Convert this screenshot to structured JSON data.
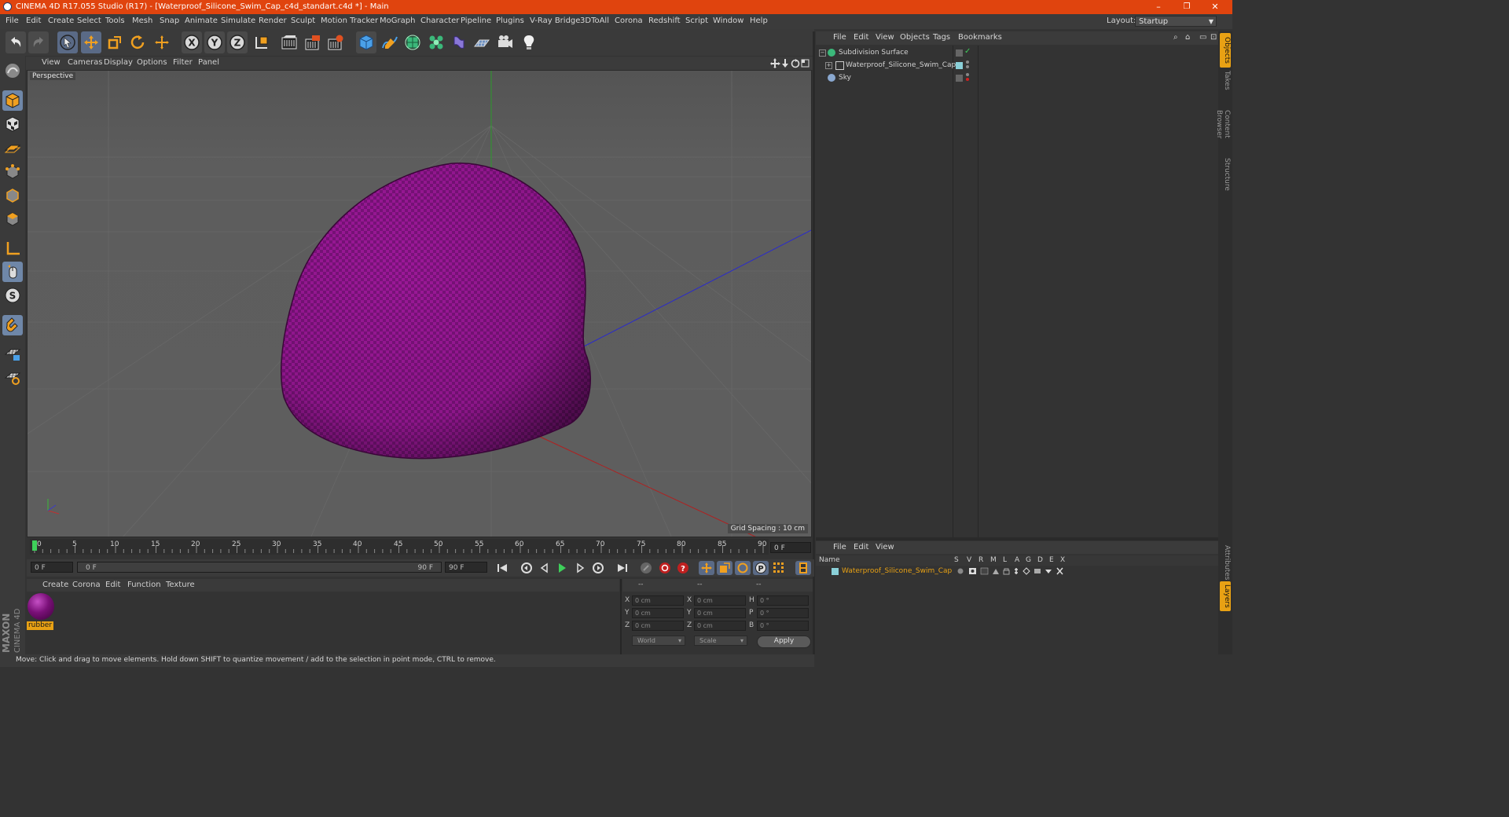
{
  "window": {
    "title": "CINEMA 4D R17.055 Studio (R17) - [Waterproof_Silicone_Swim_Cap_c4d_standart.c4d *] - Main",
    "min_glyph": "–",
    "max_glyph": "❐",
    "close_glyph": "✕"
  },
  "menu": [
    "File",
    "Edit",
    "Create",
    "Select",
    "Tools",
    "Mesh",
    "Snap",
    "Animate",
    "Simulate",
    "Render",
    "Sculpt",
    "Motion Tracker",
    "MoGraph",
    "Character",
    "Pipeline",
    "Plugins",
    "V-Ray Bridge",
    "3DToAll",
    "Corona",
    "Redshift",
    "Script",
    "Window",
    "Help"
  ],
  "layout": {
    "label": "Layout:",
    "value": "Startup"
  },
  "toolbar": {
    "icons": [
      "undo-icon",
      "redo-icon",
      "select-arrow-icon",
      "move-icon",
      "scale-icon",
      "rotate-icon",
      "last-tool-icon",
      "x-axis-icon",
      "y-axis-icon",
      "z-axis-icon",
      "world-coordinates-icon",
      "render-view-icon",
      "render-picture-viewer-icon",
      "edit-render-settings-icon",
      "cube-icon",
      "pen-spline-icon",
      "subdivision-icon",
      "cloner-icon",
      "deformer-icon",
      "floor-icon",
      "camera-icon",
      "light-icon"
    ],
    "axis": [
      "X",
      "Y",
      "Z"
    ]
  },
  "left_palette": {
    "icons": [
      "make-editable-icon",
      "model-mode-icon",
      "texture-mode-icon",
      "workplane-icon",
      "points-mode-icon",
      "edges-mode-icon",
      "polygons-mode-icon",
      "axis-mode-icon",
      "tweak-mode-icon",
      "solo-icon",
      "snap-magnet-icon",
      "lock-workplane-icon",
      "quantize-icon"
    ],
    "brand": "MAXON",
    "product": "CINEMA 4D",
    "solo_letter": "S"
  },
  "viewport": {
    "menu": [
      "View",
      "Cameras",
      "Display",
      "Options",
      "Filter",
      "Panel"
    ],
    "label": "Perspective",
    "grid_spacing": "Grid Spacing : 10 cm",
    "nav_icons": [
      "move-view-icon",
      "zoom-view-icon",
      "rotate-view-icon",
      "toggle-layout-icon"
    ],
    "object": "Waterproof_Silicone_Swim_Cap",
    "object_color": "#a0189c"
  },
  "timeline": {
    "ticks": [
      "0",
      "5",
      "10",
      "15",
      "20",
      "25",
      "30",
      "35",
      "40",
      "45",
      "50",
      "55",
      "60",
      "65",
      "70",
      "75",
      "80",
      "85",
      "90"
    ],
    "current_frame": "0 F",
    "start_field": "0 F",
    "range_start": "0 F",
    "range_end": "90 F",
    "end_field": "90 F"
  },
  "material_manager": {
    "menu": [
      "Create",
      "Corona",
      "Edit",
      "Function",
      "Texture"
    ],
    "materials": [
      {
        "name": "rubber",
        "color": "#7a1078"
      }
    ]
  },
  "coordinates": {
    "headers": [
      "--",
      "--",
      "--"
    ],
    "rows": [
      {
        "a": "X",
        "a_val": "0 cm",
        "b": "X",
        "b_val": "0 cm",
        "c": "H",
        "c_val": "0 °"
      },
      {
        "a": "Y",
        "a_val": "0 cm",
        "b": "Y",
        "b_val": "0 cm",
        "c": "P",
        "c_val": "0 °"
      },
      {
        "a": "Z",
        "a_val": "0 cm",
        "b": "Z",
        "b_val": "0 cm",
        "c": "B",
        "c_val": "0 °"
      }
    ],
    "space": "World",
    "mode": "Scale",
    "apply": "Apply"
  },
  "status": {
    "text": "Move: Click and drag to move elements. Hold down SHIFT to quantize movement / add to the selection in point mode, CTRL to remove."
  },
  "object_manager": {
    "menu": [
      "File",
      "Edit",
      "View",
      "Objects",
      "Tags",
      "Bookmarks"
    ],
    "objects": [
      {
        "name": "Subdivision Surface",
        "icon": "subdivision-icon"
      },
      {
        "name": "Waterproof_Silicone_Swim_Cap",
        "icon": "polygon-object-icon"
      },
      {
        "name": "Sky",
        "icon": "sky-icon"
      }
    ]
  },
  "layer_manager": {
    "menu": [
      "File",
      "Edit",
      "View"
    ],
    "columns": [
      "Name",
      "S",
      "V",
      "R",
      "M",
      "L",
      "A",
      "G",
      "D",
      "E",
      "X"
    ],
    "layers": [
      {
        "name": "Waterproof_Silicone_Swim_Cap",
        "color": "#e8a114"
      }
    ]
  },
  "right_tabs": [
    "Objects",
    "Takes",
    "Content Browser",
    "Structure",
    "Attributes",
    "Layers"
  ],
  "colors": {
    "title_bar": "#e0440e",
    "accent": "#e8a114",
    "selection": "#5a6a86"
  }
}
